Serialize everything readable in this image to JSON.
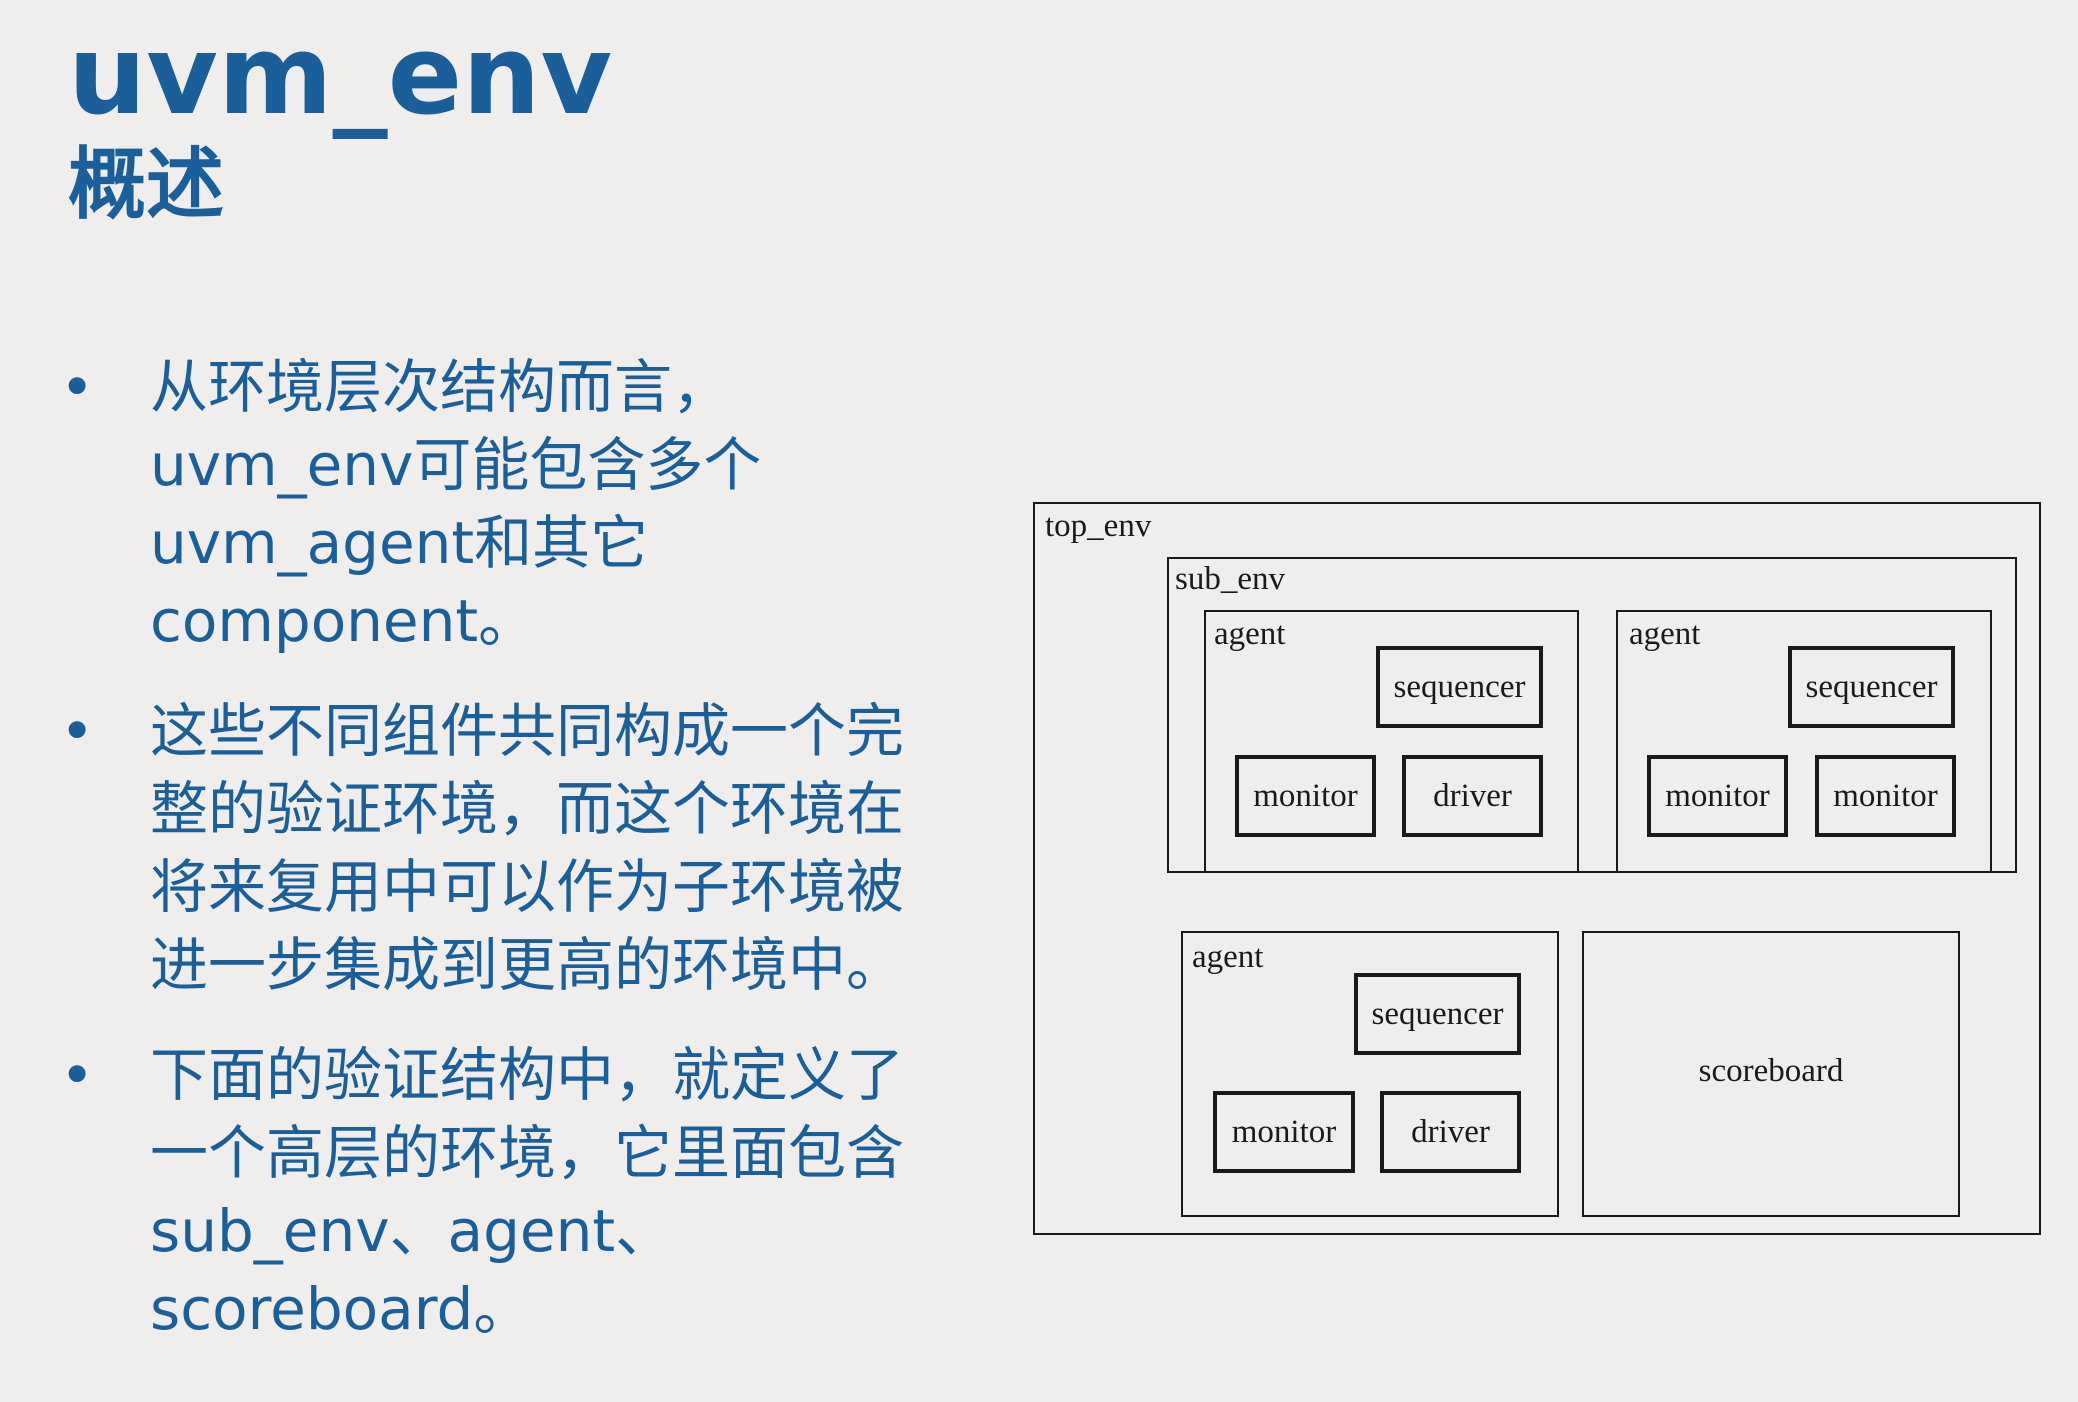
{
  "slide": {
    "title": "uvm_env",
    "subtitle": "概述"
  },
  "bullets": [
    {
      "lines": [
        "从环境层次结构而言，",
        "uvm_env可能包含多个",
        "uvm_agent和其它",
        "component。"
      ]
    },
    {
      "lines": [
        "这些不同组件共同构成一个完",
        "整的验证环境，而这个环境在",
        "将来复用中可以作为子环境被",
        "进一步集成到更高的环境中。"
      ]
    },
    {
      "lines": [
        "下面的验证结构中，就定义了",
        "一个高层的环境，它里面包含",
        "sub_env、agent、",
        "scoreboard。"
      ]
    }
  ],
  "bullet_symbol": "•",
  "diagram": {
    "top_env": {
      "label": "top_env",
      "sub_env": {
        "label": "sub_env",
        "agents": [
          {
            "label": "agent",
            "sequencer": "sequencer",
            "left": "monitor",
            "right": "driver"
          },
          {
            "label": "agent",
            "sequencer": "sequencer",
            "left": "monitor",
            "right": "monitor"
          }
        ]
      },
      "agent": {
        "label": "agent",
        "sequencer": "sequencer",
        "left": "monitor",
        "right": "driver"
      },
      "scoreboard": {
        "label": "scoreboard"
      }
    }
  },
  "colors": {
    "accent": "#1a5f99",
    "background": "#efeeed",
    "diagram_line": "#1a1a1a"
  }
}
